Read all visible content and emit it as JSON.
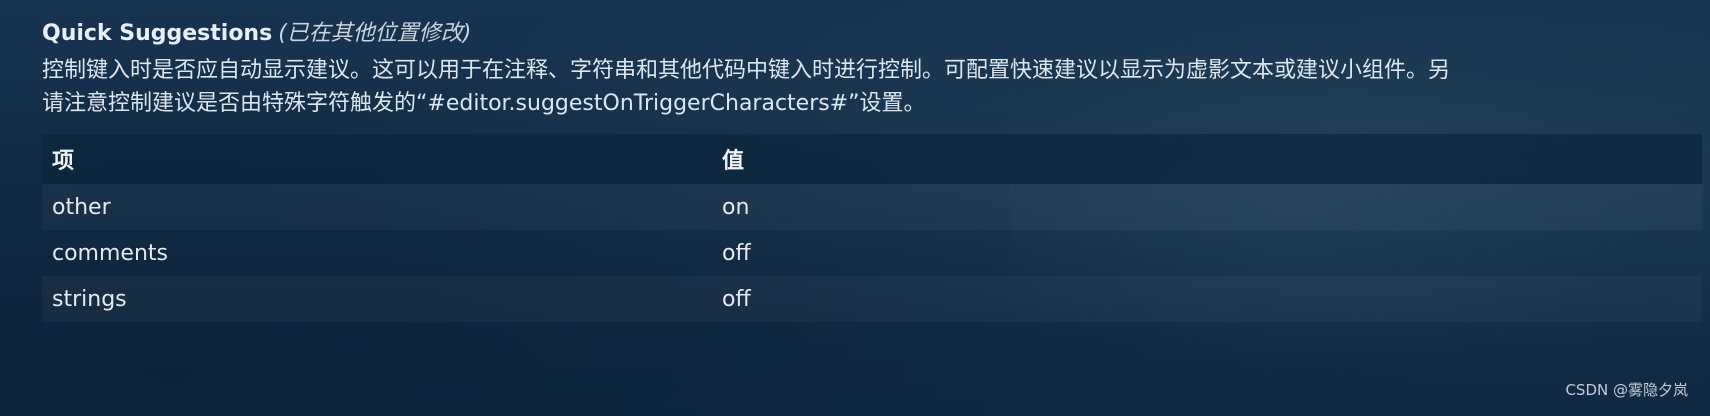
{
  "setting": {
    "title": "Quick Suggestions",
    "modified_note": "(已在其他位置修改)",
    "description_line1": "控制键入时是否应自动显示建议。这可以用于在注释、字符串和其他代码中键入时进行控制。可配置快速建议以显示为虚影文本或建议小组件。另",
    "description_line2": "请注意控制建议是否由特殊字符触发的“#editor.suggestOnTriggerCharacters#”设置。"
  },
  "table": {
    "headers": {
      "key": "项",
      "value": "值"
    },
    "rows": [
      {
        "key": "other",
        "value": "on"
      },
      {
        "key": "comments",
        "value": "off"
      },
      {
        "key": "strings",
        "value": "off"
      }
    ]
  },
  "watermark": "CSDN @雾隐夕岚",
  "colors": {
    "background": "#14304a",
    "text": "#e6edf3"
  }
}
